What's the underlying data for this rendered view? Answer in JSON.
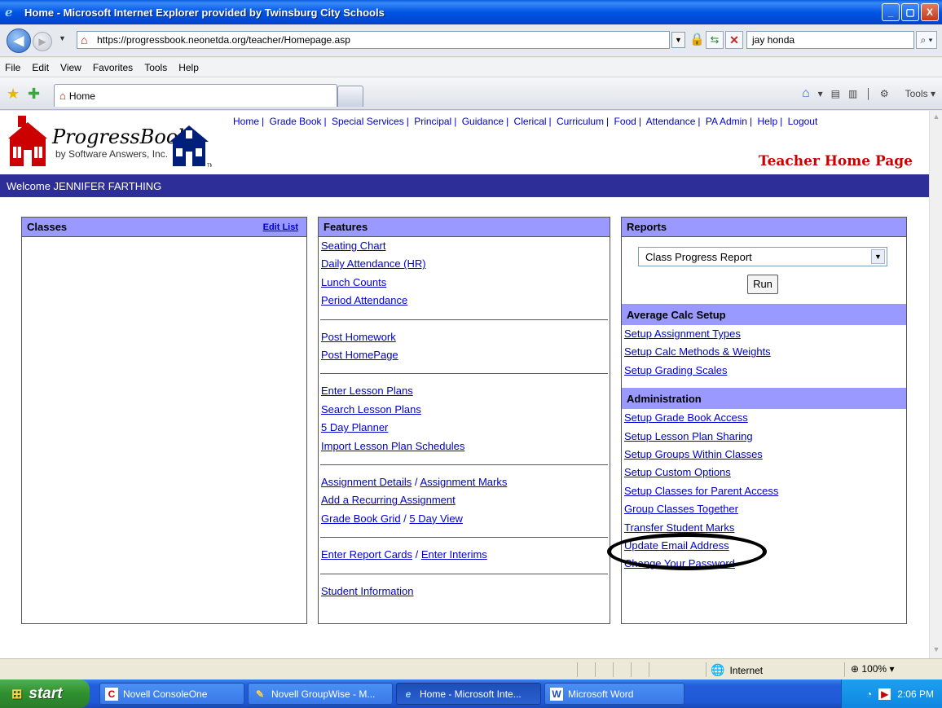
{
  "window": {
    "title": "Home - Microsoft Internet Explorer provided by Twinsburg City Schools",
    "min": "_",
    "max": "▢",
    "close": "X"
  },
  "address": {
    "url": "https://progressbook.neonetda.org/teacher/Homepage.asp",
    "search_value": "jay honda"
  },
  "menu": [
    "File",
    "Edit",
    "View",
    "Favorites",
    "Tools",
    "Help"
  ],
  "tab": {
    "label": "Home"
  },
  "command": {
    "tools_label": "Tools"
  },
  "logo": {
    "brand": "ProgressBook",
    "by": "by Software Answers, Inc.",
    "tm": "TM"
  },
  "topnav": [
    "Home",
    "Grade Book",
    "Special Services",
    "Principal",
    "Guidance",
    "Clerical",
    "Curriculum",
    "Food",
    "Attendance",
    "PA Admin",
    "Help",
    "Logout"
  ],
  "page_title": "Teacher Home Page",
  "welcome": "Welcome JENNIFER FARTHING",
  "classes": {
    "title": "Classes",
    "edit_list": "Edit List"
  },
  "features": {
    "title": "Features",
    "group1": [
      "Seating Chart",
      "Daily Attendance (HR)",
      "Lunch Counts",
      "Period Attendance"
    ],
    "group2": [
      "Post Homework",
      "Post HomePage"
    ],
    "group3": [
      "Enter Lesson Plans",
      "Search Lesson Plans",
      "5 Day Planner",
      "Import Lesson Plan Schedules"
    ],
    "assignment_details": "Assignment Details",
    "assignment_marks": "Assignment Marks",
    "add_recurring": "Add a Recurring Assignment",
    "grade_book_grid": "Grade Book Grid",
    "five_day_view": "5 Day View",
    "enter_report_cards": "Enter Report Cards",
    "enter_interims": "Enter Interims",
    "student_information": "Student Information",
    "slash": "/"
  },
  "reports": {
    "title": "Reports",
    "selected": "Class Progress Report",
    "run_label": "Run",
    "avg_title": "Average Calc Setup",
    "avg_links": [
      "Setup Assignment Types",
      "Setup Calc Methods & Weights",
      "Setup Grading Scales"
    ],
    "admin_title": "Administration",
    "admin_links": [
      "Setup Grade Book Access",
      "Setup Lesson Plan Sharing",
      "Setup Groups Within Classes",
      "Setup Custom Options",
      "Setup Classes for Parent Access",
      "Group Classes Together",
      "Transfer Student Marks",
      "Update Email Address",
      "Change Your Password"
    ]
  },
  "status": {
    "zone": "Internet",
    "zoom": "100%"
  },
  "taskbar": {
    "start": "start",
    "buttons": [
      "Novell ConsoleOne",
      "Novell GroupWise - M...",
      "Home - Microsoft Inte...",
      "Microsoft Word"
    ],
    "clock": "2:06 PM"
  }
}
